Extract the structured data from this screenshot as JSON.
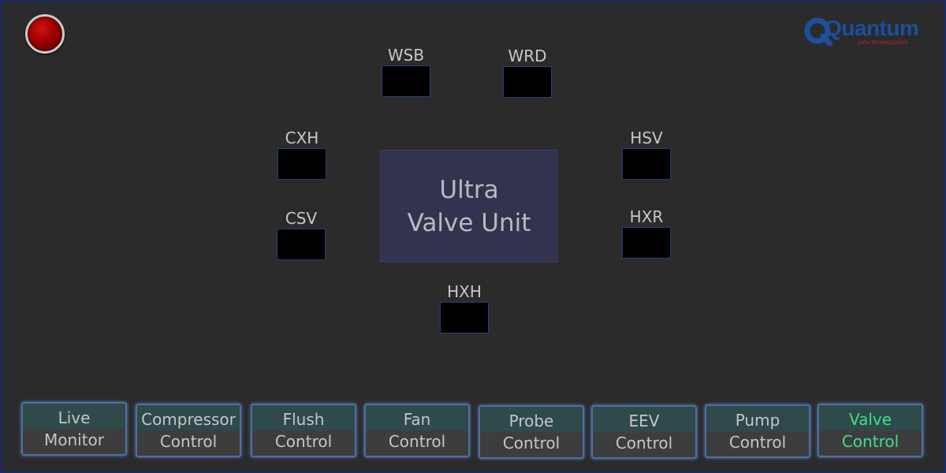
{
  "brand": {
    "logo_main": "Quantum",
    "logo_sub": "DATA TECHNOLOGIES",
    "colors": {
      "logo_blue": "#1c4f9c",
      "logo_red": "#c0272d"
    }
  },
  "status": {
    "indicator_icon": "red-status-led",
    "color": "#d01010"
  },
  "unit": {
    "line1": "Ultra",
    "line2": "Valve Unit"
  },
  "valves": {
    "wsb": "WSB",
    "wrd": "WRD",
    "cxh": "CXH",
    "hsv": "HSV",
    "csv": "CSV",
    "hxr": "HXR",
    "hxh": "HXH"
  },
  "nav": {
    "active_color": "#3ee08c",
    "items": [
      {
        "line1": "Live",
        "line2": "Monitor"
      },
      {
        "line1": "Compressor",
        "line2": "Control"
      },
      {
        "line1": "Flush",
        "line2": "Control"
      },
      {
        "line1": "Fan",
        "line2": "Control"
      },
      {
        "line1": "Probe",
        "line2": "Control"
      },
      {
        "line1": "EEV",
        "line2": "Control"
      },
      {
        "line1": "Pump",
        "line2": "Control"
      },
      {
        "line1": "Valve",
        "line2": "Control"
      }
    ]
  }
}
